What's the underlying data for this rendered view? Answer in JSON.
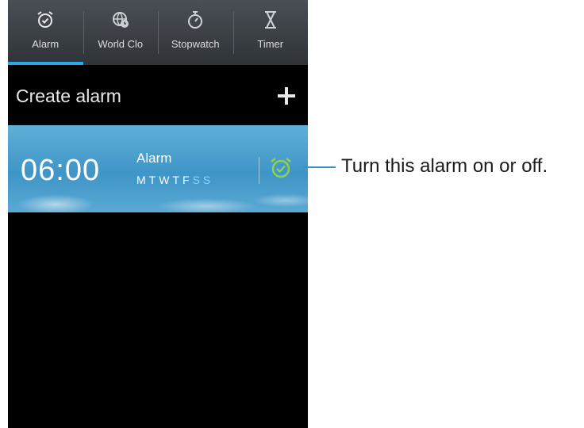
{
  "tabs": [
    {
      "label": "Alarm",
      "icon": "alarm-clock-icon",
      "active": true
    },
    {
      "label": "World Clo",
      "icon": "globe-clock-icon",
      "active": false
    },
    {
      "label": "Stopwatch",
      "icon": "stopwatch-icon",
      "active": false
    },
    {
      "label": "Timer",
      "icon": "hourglass-icon",
      "active": false
    }
  ],
  "create_alarm": {
    "label": "Create alarm",
    "icon": "plus-icon"
  },
  "alarm_item": {
    "time": "06:00",
    "name": "Alarm",
    "days": [
      "M",
      "T",
      "W",
      "T",
      "F",
      "S",
      "S"
    ],
    "weekend_color": "#7fd9ff",
    "toggle_icon": "alarm-toggle-icon",
    "toggle_color": "#8fd14f"
  },
  "callout": {
    "text": "Turn this alarm on or off."
  },
  "colors": {
    "accent": "#2aa9e5",
    "callout_line": "#3a8fc0"
  }
}
